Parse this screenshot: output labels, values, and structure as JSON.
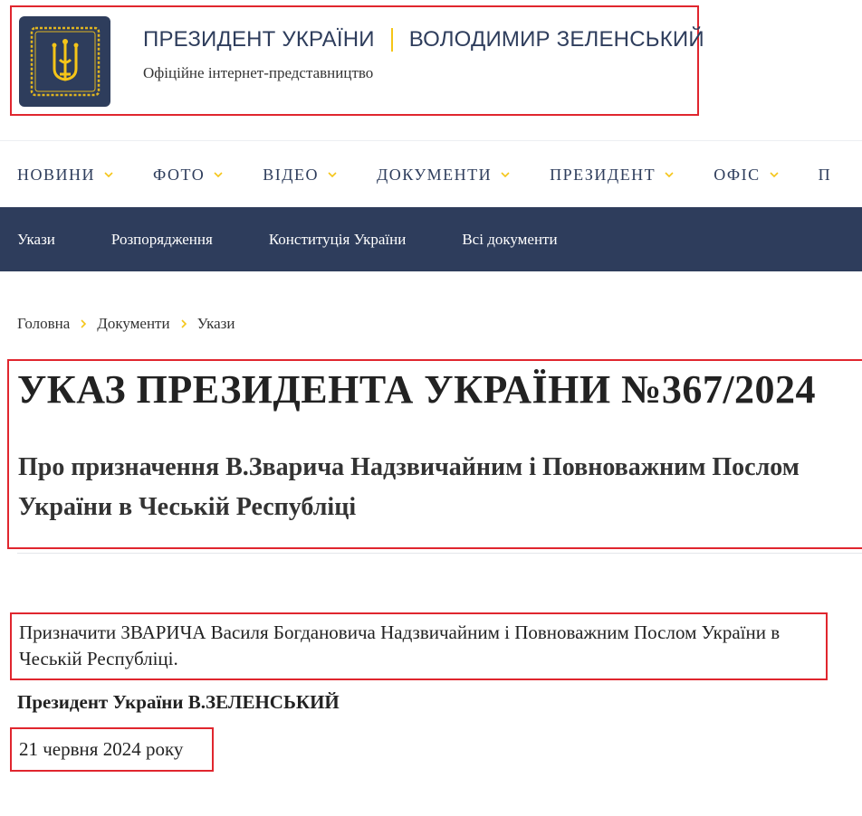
{
  "header": {
    "title_left": "ПРЕЗИДЕНТ УКРАЇНИ",
    "title_right": "ВОЛОДИМИР ЗЕЛЕНСЬКИЙ",
    "subtitle": "Офіційне інтернет-представництво",
    "logo_icon": "trident-coat-of-arms-icon"
  },
  "main_nav": {
    "items": [
      {
        "label": "НОВИНИ"
      },
      {
        "label": "ФОТО"
      },
      {
        "label": "ВІДЕО"
      },
      {
        "label": "ДОКУМЕНТИ"
      },
      {
        "label": "ПРЕЗИДЕНТ"
      },
      {
        "label": "ОФІС"
      },
      {
        "label": "П"
      }
    ]
  },
  "sub_nav": {
    "items": [
      {
        "label": "Укази"
      },
      {
        "label": "Розпорядження"
      },
      {
        "label": "Конституція України"
      },
      {
        "label": "Всі документи"
      }
    ]
  },
  "breadcrumb": {
    "items": [
      "Головна",
      "Документи",
      "Укази"
    ]
  },
  "document": {
    "title": "УКАЗ ПРЕЗИДЕНТА УКРАЇНИ №367/2024",
    "subtitle": "Про призначення В.Зварича Надзвичайним і Повноважним Послом України в Чеській Республіці",
    "body": "Призначити ЗВАРИЧА Василя Богдановича Надзвичайним і Повноважним Послом України в Чеській Республіці.",
    "signature": "Президент України В.ЗЕЛЕНСЬКИЙ",
    "date": "21 червня 2024 року"
  },
  "colors": {
    "brand_navy": "#2e3d5c",
    "accent_gold": "#f5c518",
    "highlight_red": "#e0262e"
  }
}
